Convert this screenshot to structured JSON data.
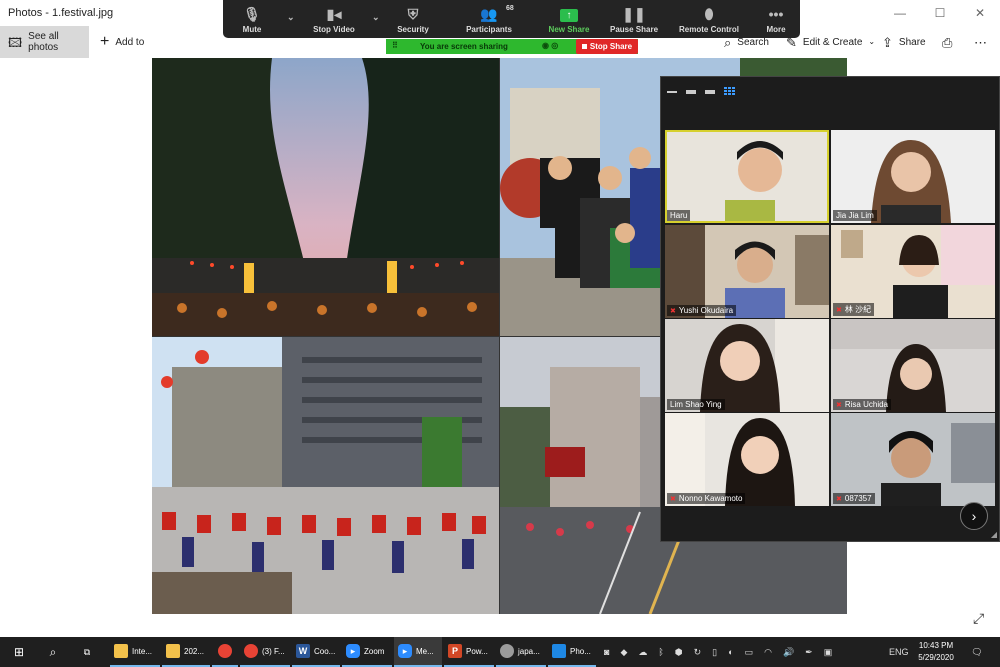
{
  "photos_app": {
    "window_title": "Photos - 1.festival.jpg",
    "see_all_label": "See all photos",
    "add_to_label": "Add to",
    "search_label": "Search",
    "edit_create_label": "Edit & Create",
    "share_label": "Share"
  },
  "zoom_toolbar": {
    "mute": "Mute",
    "stop_video": "Stop Video",
    "security": "Security",
    "participants": "Participants",
    "participant_count": "68",
    "new_share": "New Share",
    "pause_share": "Pause Share",
    "remote_control": "Remote Control",
    "more": "More"
  },
  "share_banner": {
    "status_text": "You are screen sharing",
    "stop_label": "Stop Share"
  },
  "gallery": {
    "participants": [
      {
        "name": "Haru",
        "active_speaker": true,
        "muted": false
      },
      {
        "name": "Jia Jia Lim",
        "active_speaker": false,
        "muted": false
      },
      {
        "name": "Yushi Okudaira",
        "active_speaker": false,
        "muted": true
      },
      {
        "name": "林 沙紀",
        "active_speaker": false,
        "muted": true
      },
      {
        "name": "Lim Shao Ying",
        "active_speaker": false,
        "muted": false
      },
      {
        "name": "Risa Uchida",
        "active_speaker": false,
        "muted": true
      },
      {
        "name": "Nonno Kawamoto",
        "active_speaker": false,
        "muted": true
      },
      {
        "name": "087357",
        "active_speaker": false,
        "muted": true
      }
    ]
  },
  "taskbar": {
    "apps": [
      {
        "label": "Inte...",
        "icon": "folder-icon",
        "color": "#f3c14b"
      },
      {
        "label": "202...",
        "icon": "folder-icon",
        "color": "#f3c14b"
      },
      {
        "label": "",
        "icon": "chrome-icon",
        "color": "#e84335"
      },
      {
        "label": "(3) F...",
        "icon": "chrome-icon",
        "color": "#e84335"
      },
      {
        "label": "Coo...",
        "icon": "word-icon",
        "color": "#2b579a"
      },
      {
        "label": "Zoom",
        "icon": "zoom-icon",
        "color": "#2d8cff"
      },
      {
        "label": "Me...",
        "icon": "zoom-meeting-icon",
        "color": "#2d8cff"
      },
      {
        "label": "Pow...",
        "icon": "powerpoint-icon",
        "color": "#d24726"
      },
      {
        "label": "japa...",
        "icon": "image-viewer-icon",
        "color": "#9b9b9b"
      },
      {
        "label": "Pho...",
        "icon": "photos-icon",
        "color": "#1e88e5"
      }
    ],
    "language": "ENG",
    "time": "10:43 PM",
    "date": "5/29/2020"
  },
  "colors": {
    "zoom_bar": "#242424",
    "share_green": "#2eb82e",
    "stop_red": "#e02828",
    "active_speaker": "#d6d02e"
  }
}
